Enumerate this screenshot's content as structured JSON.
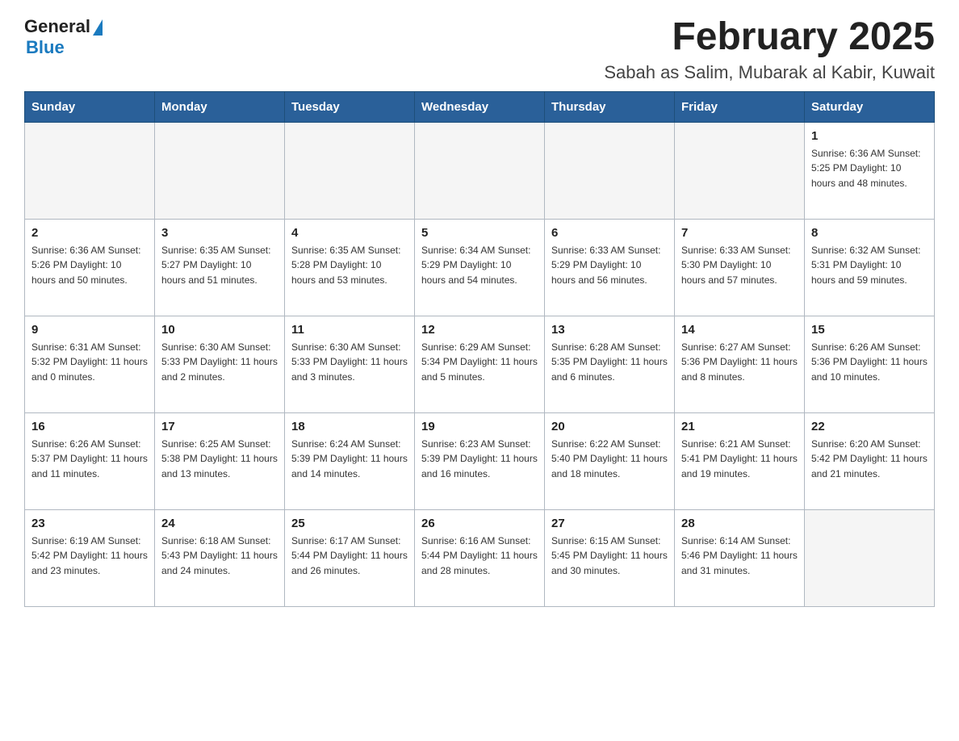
{
  "logo": {
    "text_general": "General",
    "text_blue": "Blue"
  },
  "title": "February 2025",
  "subtitle": "Sabah as Salim, Mubarak al Kabir, Kuwait",
  "weekdays": [
    "Sunday",
    "Monday",
    "Tuesday",
    "Wednesday",
    "Thursday",
    "Friday",
    "Saturday"
  ],
  "weeks": [
    [
      {
        "day": "",
        "info": ""
      },
      {
        "day": "",
        "info": ""
      },
      {
        "day": "",
        "info": ""
      },
      {
        "day": "",
        "info": ""
      },
      {
        "day": "",
        "info": ""
      },
      {
        "day": "",
        "info": ""
      },
      {
        "day": "1",
        "info": "Sunrise: 6:36 AM\nSunset: 5:25 PM\nDaylight: 10 hours\nand 48 minutes."
      }
    ],
    [
      {
        "day": "2",
        "info": "Sunrise: 6:36 AM\nSunset: 5:26 PM\nDaylight: 10 hours\nand 50 minutes."
      },
      {
        "day": "3",
        "info": "Sunrise: 6:35 AM\nSunset: 5:27 PM\nDaylight: 10 hours\nand 51 minutes."
      },
      {
        "day": "4",
        "info": "Sunrise: 6:35 AM\nSunset: 5:28 PM\nDaylight: 10 hours\nand 53 minutes."
      },
      {
        "day": "5",
        "info": "Sunrise: 6:34 AM\nSunset: 5:29 PM\nDaylight: 10 hours\nand 54 minutes."
      },
      {
        "day": "6",
        "info": "Sunrise: 6:33 AM\nSunset: 5:29 PM\nDaylight: 10 hours\nand 56 minutes."
      },
      {
        "day": "7",
        "info": "Sunrise: 6:33 AM\nSunset: 5:30 PM\nDaylight: 10 hours\nand 57 minutes."
      },
      {
        "day": "8",
        "info": "Sunrise: 6:32 AM\nSunset: 5:31 PM\nDaylight: 10 hours\nand 59 minutes."
      }
    ],
    [
      {
        "day": "9",
        "info": "Sunrise: 6:31 AM\nSunset: 5:32 PM\nDaylight: 11 hours\nand 0 minutes."
      },
      {
        "day": "10",
        "info": "Sunrise: 6:30 AM\nSunset: 5:33 PM\nDaylight: 11 hours\nand 2 minutes."
      },
      {
        "day": "11",
        "info": "Sunrise: 6:30 AM\nSunset: 5:33 PM\nDaylight: 11 hours\nand 3 minutes."
      },
      {
        "day": "12",
        "info": "Sunrise: 6:29 AM\nSunset: 5:34 PM\nDaylight: 11 hours\nand 5 minutes."
      },
      {
        "day": "13",
        "info": "Sunrise: 6:28 AM\nSunset: 5:35 PM\nDaylight: 11 hours\nand 6 minutes."
      },
      {
        "day": "14",
        "info": "Sunrise: 6:27 AM\nSunset: 5:36 PM\nDaylight: 11 hours\nand 8 minutes."
      },
      {
        "day": "15",
        "info": "Sunrise: 6:26 AM\nSunset: 5:36 PM\nDaylight: 11 hours\nand 10 minutes."
      }
    ],
    [
      {
        "day": "16",
        "info": "Sunrise: 6:26 AM\nSunset: 5:37 PM\nDaylight: 11 hours\nand 11 minutes."
      },
      {
        "day": "17",
        "info": "Sunrise: 6:25 AM\nSunset: 5:38 PM\nDaylight: 11 hours\nand 13 minutes."
      },
      {
        "day": "18",
        "info": "Sunrise: 6:24 AM\nSunset: 5:39 PM\nDaylight: 11 hours\nand 14 minutes."
      },
      {
        "day": "19",
        "info": "Sunrise: 6:23 AM\nSunset: 5:39 PM\nDaylight: 11 hours\nand 16 minutes."
      },
      {
        "day": "20",
        "info": "Sunrise: 6:22 AM\nSunset: 5:40 PM\nDaylight: 11 hours\nand 18 minutes."
      },
      {
        "day": "21",
        "info": "Sunrise: 6:21 AM\nSunset: 5:41 PM\nDaylight: 11 hours\nand 19 minutes."
      },
      {
        "day": "22",
        "info": "Sunrise: 6:20 AM\nSunset: 5:42 PM\nDaylight: 11 hours\nand 21 minutes."
      }
    ],
    [
      {
        "day": "23",
        "info": "Sunrise: 6:19 AM\nSunset: 5:42 PM\nDaylight: 11 hours\nand 23 minutes."
      },
      {
        "day": "24",
        "info": "Sunrise: 6:18 AM\nSunset: 5:43 PM\nDaylight: 11 hours\nand 24 minutes."
      },
      {
        "day": "25",
        "info": "Sunrise: 6:17 AM\nSunset: 5:44 PM\nDaylight: 11 hours\nand 26 minutes."
      },
      {
        "day": "26",
        "info": "Sunrise: 6:16 AM\nSunset: 5:44 PM\nDaylight: 11 hours\nand 28 minutes."
      },
      {
        "day": "27",
        "info": "Sunrise: 6:15 AM\nSunset: 5:45 PM\nDaylight: 11 hours\nand 30 minutes."
      },
      {
        "day": "28",
        "info": "Sunrise: 6:14 AM\nSunset: 5:46 PM\nDaylight: 11 hours\nand 31 minutes."
      },
      {
        "day": "",
        "info": ""
      }
    ]
  ]
}
